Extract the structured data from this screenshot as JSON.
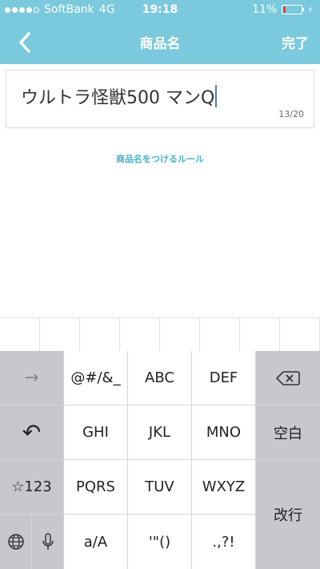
{
  "status_bar": {
    "carrier": "SoftBank",
    "network": "4G",
    "time": "19:18",
    "battery": "11%"
  },
  "nav": {
    "title": "商品名",
    "done_label": "完了"
  },
  "field": {
    "value": "ウルトラ怪獣500 マンQ",
    "counter": "13/20"
  },
  "rules_link": "商品名をつけるルール",
  "keyboard": {
    "arrow_label": "→",
    "undo_label": "↶",
    "mode_label": "☆123",
    "keys": {
      "k1": "@#/&_",
      "k2": "ABC",
      "k3": "DEF",
      "k4": "GHI",
      "k5": "JKL",
      "k6": "MNO",
      "k7": "PQRS",
      "k8": "TUV",
      "k9": "WXYZ",
      "k10": "a/A",
      "k11": "'\"()",
      "k12": ".,?!"
    },
    "space_label": "空白",
    "return_label": "改行"
  }
}
